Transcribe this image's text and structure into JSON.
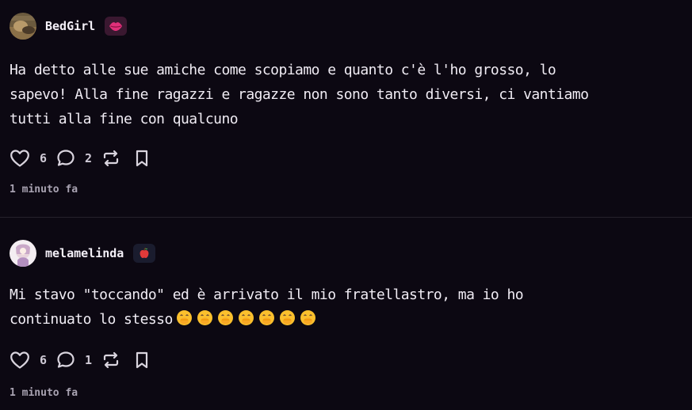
{
  "posts": [
    {
      "username": "BedGirl",
      "badge_icon": "kiss-lips-icon",
      "text": "Ha detto alle sue amiche come scopiamo e quanto c'è l'ho grosso, lo\nsapevo! Alla fine ragazzi e ragazze non sono tanto diversi, ci vantiamo\ntutti alla fine con qualcuno",
      "likes": "6",
      "comments": "2",
      "timestamp": "1 minuto fa"
    },
    {
      "username": "melamelinda",
      "badge_icon": "apple-icon",
      "text": "Mi stavo \"toccando\" ed è arrivato il mio fratellastro, ma io ho\ncontinuato lo stesso",
      "emoji": "🤭🤭🤭🤭🤭🤭🤭",
      "likes": "6",
      "comments": "1",
      "timestamp": "1 minuto fa"
    }
  ],
  "colors": {
    "background": "#0c0812",
    "text": "#f0ecf4",
    "muted": "#a9a3b2",
    "divider": "#26222c"
  }
}
